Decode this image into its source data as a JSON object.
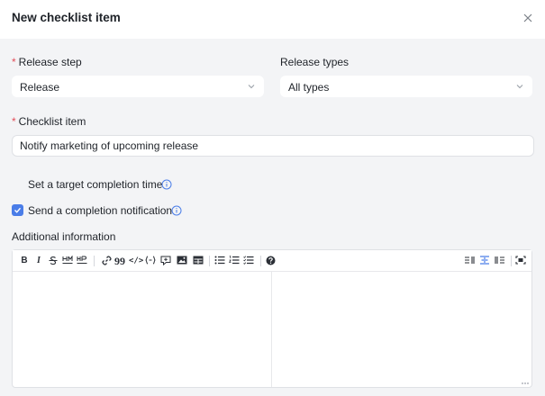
{
  "dialog": {
    "title": "New checklist item"
  },
  "form": {
    "release_step": {
      "label": "Release step",
      "required_mark": "*",
      "value": "Release"
    },
    "release_types": {
      "label": "Release types",
      "value": "All types"
    },
    "checklist_item": {
      "label": "Checklist item",
      "required_mark": "*",
      "value": "Notify marketing of upcoming release"
    },
    "target_time": {
      "label": "Set a target completion time",
      "checked": false
    },
    "notification": {
      "label": "Send a completion notification",
      "checked": true
    },
    "additional_info": {
      "label": "Additional information"
    }
  },
  "editor": {
    "toolbar": {
      "bold": "B",
      "italic": "I",
      "quote": "99",
      "code": "</>"
    }
  },
  "colors": {
    "accent": "#4a7de8",
    "required": "#e34d59",
    "background": "#f3f4f6"
  }
}
